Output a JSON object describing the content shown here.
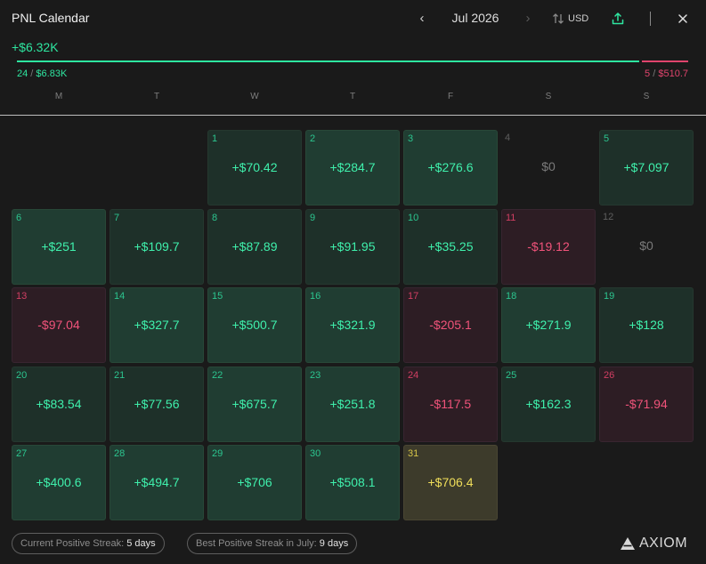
{
  "header": {
    "title": "PNL Calendar",
    "month": "Jul 2026",
    "currency": "USD",
    "prev_icon": "chevron-left-icon",
    "next_icon": "chevron-right-icon",
    "currency_icon": "arrows-up-down-icon",
    "share_icon": "share-upload-icon",
    "close_icon": "close-icon"
  },
  "summary": {
    "total": "+$6.32K",
    "positive_days": "24",
    "positive_amount": "$6.83K",
    "negative_days": "5",
    "negative_amount": "$510.7",
    "positive_share": 0.9304
  },
  "weekdays": [
    "M",
    "T",
    "W",
    "T",
    "F",
    "S",
    "S"
  ],
  "days": [
    {
      "day": "1",
      "value": "+$70.42",
      "type": "pos",
      "intensity": "weak"
    },
    {
      "day": "2",
      "value": "+$284.7",
      "type": "pos",
      "intensity": "strong"
    },
    {
      "day": "3",
      "value": "+$276.6",
      "type": "pos",
      "intensity": "strong"
    },
    {
      "day": "4",
      "value": "$0",
      "type": "zero",
      "intensity": "none"
    },
    {
      "day": "5",
      "value": "+$7.097",
      "type": "pos",
      "intensity": "weak"
    },
    {
      "day": "6",
      "value": "+$251",
      "type": "pos",
      "intensity": "strong"
    },
    {
      "day": "7",
      "value": "+$109.7",
      "type": "pos",
      "intensity": "weak"
    },
    {
      "day": "8",
      "value": "+$87.89",
      "type": "pos",
      "intensity": "weak"
    },
    {
      "day": "9",
      "value": "+$91.95",
      "type": "pos",
      "intensity": "weak"
    },
    {
      "day": "10",
      "value": "+$35.25",
      "type": "pos",
      "intensity": "weak"
    },
    {
      "day": "11",
      "value": "-$19.12",
      "type": "neg",
      "intensity": "weak"
    },
    {
      "day": "12",
      "value": "$0",
      "type": "zero",
      "intensity": "none"
    },
    {
      "day": "13",
      "value": "-$97.04",
      "type": "neg",
      "intensity": "weak"
    },
    {
      "day": "14",
      "value": "+$327.7",
      "type": "pos",
      "intensity": "strong"
    },
    {
      "day": "15",
      "value": "+$500.7",
      "type": "pos",
      "intensity": "strong"
    },
    {
      "day": "16",
      "value": "+$321.9",
      "type": "pos",
      "intensity": "strong"
    },
    {
      "day": "17",
      "value": "-$205.1",
      "type": "neg",
      "intensity": "strong"
    },
    {
      "day": "18",
      "value": "+$271.9",
      "type": "pos",
      "intensity": "strong"
    },
    {
      "day": "19",
      "value": "+$128",
      "type": "pos",
      "intensity": "weak"
    },
    {
      "day": "20",
      "value": "+$83.54",
      "type": "pos",
      "intensity": "weak"
    },
    {
      "day": "21",
      "value": "+$77.56",
      "type": "pos",
      "intensity": "weak"
    },
    {
      "day": "22",
      "value": "+$675.7",
      "type": "pos",
      "intensity": "strong"
    },
    {
      "day": "23",
      "value": "+$251.8",
      "type": "pos",
      "intensity": "strong"
    },
    {
      "day": "24",
      "value": "-$117.5",
      "type": "neg",
      "intensity": "strong"
    },
    {
      "day": "25",
      "value": "+$162.3",
      "type": "pos",
      "intensity": "weak"
    },
    {
      "day": "26",
      "value": "-$71.94",
      "type": "neg",
      "intensity": "weak"
    },
    {
      "day": "27",
      "value": "+$400.6",
      "type": "pos",
      "intensity": "strong"
    },
    {
      "day": "28",
      "value": "+$494.7",
      "type": "pos",
      "intensity": "strong"
    },
    {
      "day": "29",
      "value": "+$706",
      "type": "pos",
      "intensity": "strong"
    },
    {
      "day": "30",
      "value": "+$508.1",
      "type": "pos",
      "intensity": "strong"
    },
    {
      "day": "31",
      "value": "+$706.4",
      "type": "today",
      "intensity": "highlight"
    }
  ],
  "footer": {
    "current_streak_label": "Current Positive Streak:",
    "current_streak_value": "5 days",
    "best_streak_label": "Best Positive Streak in July:",
    "best_streak_value": "9 days",
    "brand": "AXIOM",
    "brand_icon": "axiom-logo-icon"
  },
  "colors": {
    "positive": "#2ee6a0",
    "negative": "#e0446c",
    "highlight": "#f0de5a",
    "background": "#1a1a1a"
  }
}
